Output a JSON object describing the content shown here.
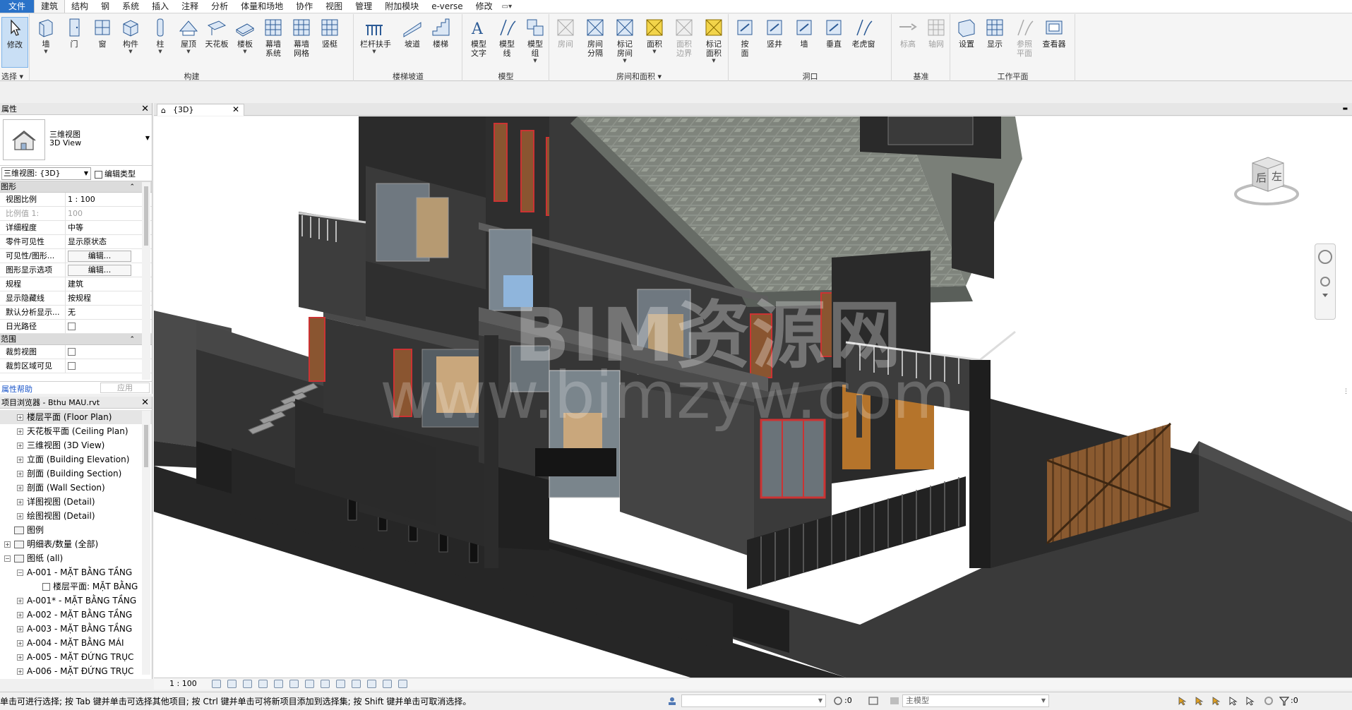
{
  "menu": {
    "tabs": [
      "文件",
      "建筑",
      "结构",
      "钢",
      "系统",
      "插入",
      "注释",
      "分析",
      "体量和场地",
      "协作",
      "视图",
      "管理",
      "附加模块",
      "e-verse",
      "修改"
    ],
    "extra": "▭▾"
  },
  "ribbon": {
    "select": {
      "modify": "修改",
      "title": "选择 ▾"
    },
    "build": {
      "title": "构建",
      "tools": [
        "墙",
        "门",
        "窗",
        "构件",
        "柱",
        "屋顶",
        "天花板",
        "楼板",
        "幕墙\n系统",
        "幕墙\n网格",
        "竖梃"
      ]
    },
    "circulation": {
      "title": "楼梯坡道",
      "tools": [
        "栏杆扶手",
        "坡道",
        "楼梯"
      ]
    },
    "model": {
      "title": "模型",
      "tools": [
        "模型\n文字",
        "模型\n线",
        "模型\n组"
      ]
    },
    "room": {
      "title": "房间和面积 ▾",
      "tools": [
        "房间",
        "房间\n分隔",
        "标记\n房间",
        "面积",
        "面积\n边界",
        "标记\n面积"
      ]
    },
    "opening": {
      "title": "洞口",
      "tools": [
        "按\n面",
        "竖井",
        "墙",
        "垂直",
        "老虎窗"
      ]
    },
    "datum": {
      "title": "基准",
      "tools": [
        "标高",
        "轴网"
      ]
    },
    "workplane": {
      "title": "工作平面",
      "tools": [
        "设置",
        "显示",
        "参照\n平面",
        "查看器"
      ]
    }
  },
  "properties": {
    "header": "属性",
    "type_line1": "三维视图",
    "type_line2": "3D View",
    "view_selector": "三维视图: {3D}",
    "edit_type": "编辑类型",
    "group_graphics": "图形",
    "group_extents": "范围",
    "rows": [
      {
        "k": "视图比例",
        "v": "1 : 100"
      },
      {
        "k": "比例值 1:",
        "v": "100"
      },
      {
        "k": "详细程度",
        "v": "中等"
      },
      {
        "k": "零件可见性",
        "v": "显示原状态"
      },
      {
        "k": "可见性/图形...",
        "v": "编辑..."
      },
      {
        "k": "图形显示选项",
        "v": "编辑..."
      },
      {
        "k": "规程",
        "v": "建筑"
      },
      {
        "k": "显示隐藏线",
        "v": "按规程"
      },
      {
        "k": "默认分析显示...",
        "v": "无"
      },
      {
        "k": "日光路径",
        "v": ""
      }
    ],
    "extent_rows": [
      {
        "k": "裁剪视图",
        "v": ""
      },
      {
        "k": "裁剪区域可见",
        "v": ""
      }
    ],
    "help": "属性帮助",
    "apply": "应用"
  },
  "browser": {
    "header": "项目浏览器 - Bthu MAU.rvt",
    "nodes": [
      {
        "label": "楼层平面 (Floor Plan)",
        "indent": 1,
        "sel": true
      },
      {
        "label": "天花板平面 (Ceiling Plan)",
        "indent": 1
      },
      {
        "label": "三维视图 (3D View)",
        "indent": 1
      },
      {
        "label": "立面 (Building Elevation)",
        "indent": 1
      },
      {
        "label": "剖面 (Building Section)",
        "indent": 1
      },
      {
        "label": "剖面 (Wall Section)",
        "indent": 1
      },
      {
        "label": "详图视图 (Detail)",
        "indent": 1
      },
      {
        "label": "绘图视图 (Detail)",
        "indent": 1
      },
      {
        "label": "图例",
        "indent": 0
      },
      {
        "label": "明细表/数量 (全部)",
        "indent": 0
      },
      {
        "label": "图纸 (all)",
        "indent": 0
      },
      {
        "label": "A-001 - MẶT BẰNG TẦNG",
        "indent": 1
      },
      {
        "label": "楼层平面: MẶT BẰNG",
        "indent": 2
      },
      {
        "label": "A-001* - MẶT BẰNG TẦNG",
        "indent": 1
      },
      {
        "label": "A-002 - MẶT BẰNG TẦNG",
        "indent": 1
      },
      {
        "label": "A-003 - MẶT BẰNG TẦNG",
        "indent": 1
      },
      {
        "label": "A-004 - MẶT BẰNG MÁI",
        "indent": 1
      },
      {
        "label": "A-005 - MẶT ĐỨNG TRỤC",
        "indent": 1
      },
      {
        "label": "A-006 - MẶT ĐỨNG TRỤC",
        "indent": 1
      }
    ]
  },
  "view": {
    "tab": "{3D}",
    "scale": "1 : 100",
    "watermark_cn": "BIM资源网",
    "watermark_url": "www.bimzyw.com",
    "viewcube": {
      "left": "左",
      "back": "后"
    }
  },
  "status": {
    "message": "单击可进行选择; 按 Tab 键并单击可选择其他项目; 按 Ctrl 键并单击可将新项目添加到选择集; 按 Shift 键并单击可取消选择。",
    "zero1": ":0",
    "model": "主模型",
    "zero2": ":0"
  }
}
